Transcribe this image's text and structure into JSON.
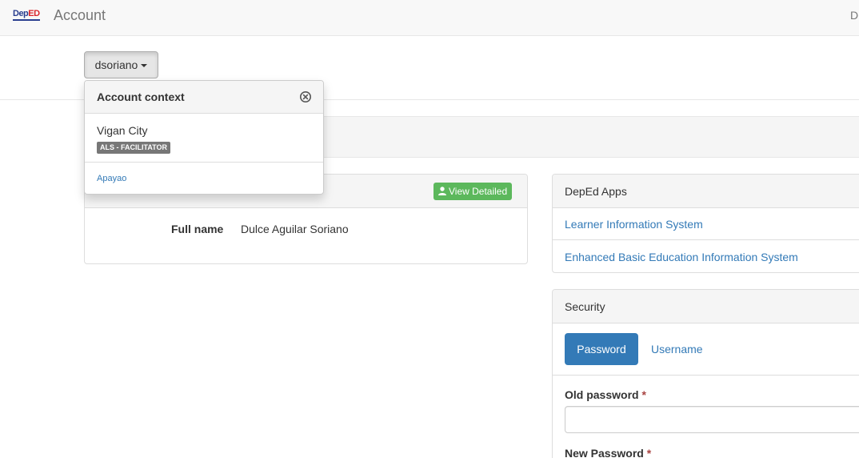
{
  "navbar": {
    "logo_dep": "Dep",
    "logo_ed": "ED",
    "title": "Account",
    "right_text": "D"
  },
  "context": {
    "username": "dsoriano"
  },
  "dropdown": {
    "title": "Account context",
    "items": [
      {
        "label": "Vigan City",
        "badge": "ALS - FACILITATOR"
      },
      {
        "label": "Apayao"
      }
    ]
  },
  "profile": {
    "view_detailed_label": "View Detailed",
    "fullname_label": "Full name",
    "fullname_value": "Dulce Aguilar Soriano"
  },
  "apps": {
    "title": "DepEd Apps",
    "links": [
      "Learner Information System",
      "Enhanced Basic Education Information System"
    ]
  },
  "security": {
    "title": "Security",
    "tabs": [
      "Password",
      "Username"
    ],
    "old_password_label": "Old password",
    "new_password_label": "New Password",
    "required_marker": "*"
  },
  "colors": {
    "primary": "#337ab7",
    "success": "#5cb85c",
    "badge": "#777777",
    "required": "#a94442"
  }
}
